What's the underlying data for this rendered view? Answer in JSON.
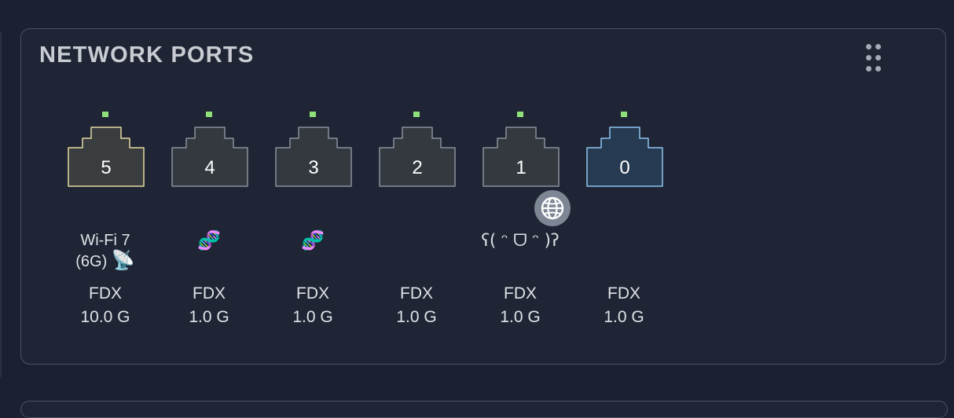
{
  "widget": {
    "title": "NETWORK PORTS"
  },
  "colors": {
    "background": "#1b2130",
    "card": "#1f2534",
    "led": "#8fe07a",
    "wifi_port_border": "#e6d9a2",
    "uplink_port_border": "#8ec4ee",
    "default_port_border": "#8a919c"
  },
  "ports": [
    {
      "number": "5",
      "label_line1": "Wi-Fi 7",
      "label_line2": "(6G)",
      "label_icon": "📡",
      "duplex": "FDX",
      "speed": "10.0 G",
      "style": "wifi"
    },
    {
      "number": "4",
      "emoji": "🧬",
      "duplex": "FDX",
      "speed": "1.0 G",
      "style": "default"
    },
    {
      "number": "3",
      "emoji": "🧬",
      "duplex": "FDX",
      "speed": "1.0 G",
      "style": "default"
    },
    {
      "number": "2",
      "duplex": "FDX",
      "speed": "1.0 G",
      "style": "default"
    },
    {
      "number": "1",
      "label": "ʕ( ᵔ ᗜ ᵔ )ʔ",
      "duplex": "FDX",
      "speed": "1.0 G",
      "style": "default",
      "badge": "globe-icon"
    },
    {
      "number": "0",
      "duplex": "FDX",
      "speed": "1.0 G",
      "style": "uplink"
    }
  ]
}
